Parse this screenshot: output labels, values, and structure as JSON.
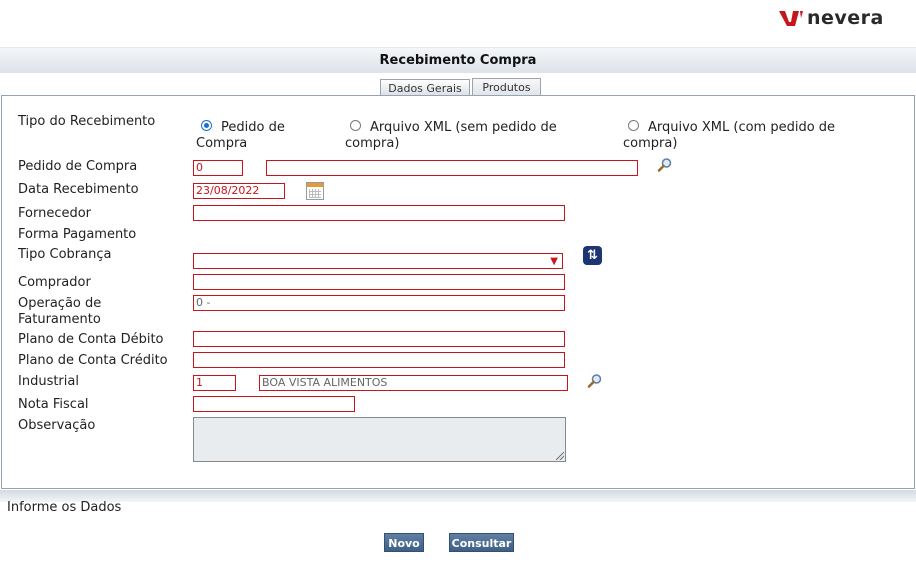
{
  "brand": {
    "name": "nevera"
  },
  "page": {
    "title": "Recebimento Compra"
  },
  "tabs": [
    {
      "label": "Dados Gerais"
    },
    {
      "label": "Produtos"
    }
  ],
  "form": {
    "tipo_recebimento": {
      "label": "Tipo do Recebimento",
      "options": [
        {
          "label": "Pedido de Compra",
          "line1": "Pedido de",
          "line2": "Compra",
          "selected": true
        },
        {
          "label": "Arquivo XML (sem pedido de compra)",
          "line1": "Arquivo XML (sem pedido de",
          "line2": "compra)",
          "selected": false
        },
        {
          "label": "Arquivo XML (com pedido de compra)",
          "line1": "Arquivo XML (com pedido de",
          "line2": "compra)",
          "selected": false
        }
      ]
    },
    "pedido_compra": {
      "label": "Pedido de Compra",
      "code": "0",
      "description": ""
    },
    "data_recebimento": {
      "label": "Data Recebimento",
      "value": "23/08/2022"
    },
    "fornecedor": {
      "label": "Fornecedor",
      "value": ""
    },
    "forma_pagamento": {
      "label": "Forma Pagamento"
    },
    "tipo_cobranca": {
      "label": "Tipo Cobrança",
      "value": ""
    },
    "comprador": {
      "label": "Comprador",
      "value": ""
    },
    "operacao_faturamento": {
      "label_line1": "Operação de",
      "label_line2": "Faturamento",
      "value": "0 -"
    },
    "plano_conta_debito": {
      "label": "Plano de Conta Débito",
      "value": ""
    },
    "plano_conta_credito": {
      "label": "Plano de Conta Crédito",
      "value": ""
    },
    "industrial": {
      "label": "Industrial",
      "code": "1",
      "name": "BOA VISTA ALIMENTOS"
    },
    "nota_fiscal": {
      "label": "Nota Fiscal",
      "value": ""
    },
    "observacao": {
      "label": "Observação",
      "value": ""
    }
  },
  "status": {
    "message": "Informe os Dados"
  },
  "buttons": {
    "novo": "Novo",
    "consultar": "Consultar"
  },
  "colors": {
    "accent_red": "#c8151b",
    "button_blue": "#4a6b91",
    "sync_blue": "#1d3570",
    "brand_red": "#c8151b"
  },
  "icons": {
    "search": "magnifier-icon",
    "calendar": "calendar-icon",
    "sync": "refresh-icon",
    "select": "chevron-down-icon"
  }
}
